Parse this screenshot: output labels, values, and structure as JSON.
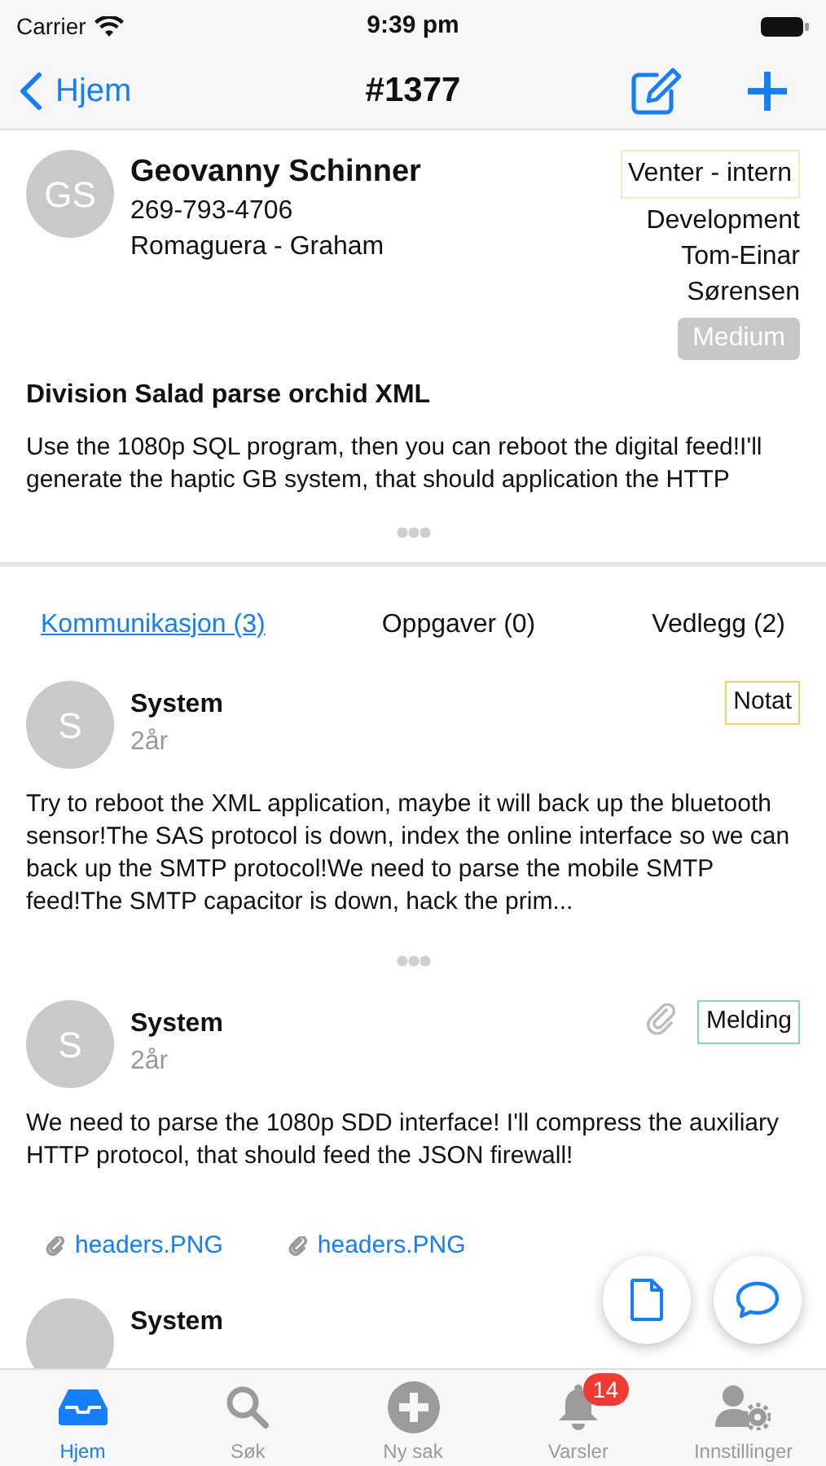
{
  "status_bar": {
    "carrier": "Carrier",
    "time": "9:39 pm"
  },
  "nav_bar": {
    "back_label": "Hjem",
    "title": "#1377"
  },
  "ticket": {
    "avatar_initials": "GS",
    "name": "Geovanny Schinner",
    "phone": "269-793-4706",
    "company": "Romaguera - Graham",
    "status": "Venter - intern",
    "department": "Development",
    "assignee": "Tom-Einar Sørensen",
    "priority": "Medium",
    "title": "Division Salad parse orchid XML",
    "description": "Use the 1080p SQL program, then you can reboot the digital feed!I'll generate the haptic GB system, that should application the HTTP"
  },
  "section_tabs": [
    {
      "label": "Kommunikasjon (3)",
      "selected": true
    },
    {
      "label": "Oppgaver (0)",
      "selected": false
    },
    {
      "label": "Vedlegg (2)",
      "selected": false
    }
  ],
  "messages": [
    {
      "avatar_initials": "S",
      "author": "System",
      "age": "2år",
      "badge": {
        "label": "Notat",
        "color": "#f2d16b"
      },
      "has_attachment": false,
      "body": "Try to reboot the XML application, maybe it will back up the bluetooth sensor!The SAS protocol is down, index the online interface so we can back up the SMTP protocol!We need to parse the mobile SMTP feed!The SMTP capacitor is down, hack the prim...",
      "truncated": true
    },
    {
      "avatar_initials": "S",
      "author": "System",
      "age": "2år",
      "badge": {
        "label": "Melding",
        "color": "#86d9a8"
      },
      "has_attachment": true,
      "body": "We need to parse the 1080p SDD interface! I'll compress the auxiliary HTTP protocol, that should feed the JSON firewall!",
      "truncated": false,
      "attachments": [
        "headers.PNG",
        "headers.PNG"
      ]
    },
    {
      "author": "System"
    }
  ],
  "tab_bar": [
    {
      "kind": "inbox",
      "label": "Hjem",
      "selected": true
    },
    {
      "kind": "search",
      "label": "Søk",
      "selected": false
    },
    {
      "kind": "plus",
      "label": "Ny sak",
      "selected": false
    },
    {
      "kind": "bell",
      "label": "Varsler",
      "selected": false,
      "badge": "14"
    },
    {
      "kind": "settings",
      "label": "Innstillinger",
      "selected": false
    }
  ]
}
